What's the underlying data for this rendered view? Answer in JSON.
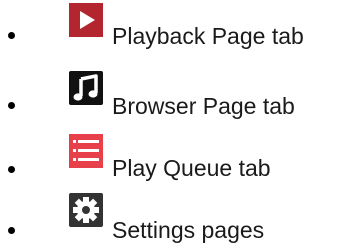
{
  "items": [
    {
      "icon": "play-icon",
      "label": "Playback Page tab",
      "icon_color": "#b3262f"
    },
    {
      "icon": "music-note-icon",
      "label": "Browser Page tab",
      "icon_color": "#111111"
    },
    {
      "icon": "list-icon",
      "label": "Play Queue tab",
      "icon_color": "#e8404a"
    },
    {
      "icon": "gear-icon",
      "label": "Settings pages",
      "icon_color": "#333333"
    }
  ]
}
